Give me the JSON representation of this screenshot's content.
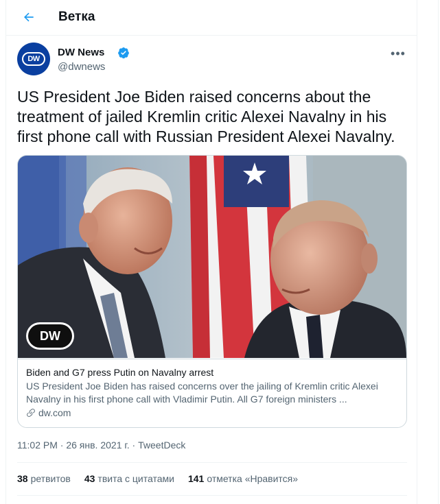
{
  "header": {
    "title": "Ветка",
    "back_icon": "arrow-left-icon"
  },
  "author": {
    "name": "DW News",
    "handle": "@dwnews",
    "avatar_text": "DW",
    "verified": true,
    "more_icon": "more-horizontal-icon"
  },
  "tweet": {
    "text": "US President Joe Biden raised concerns about the treatment of jailed Kremlin critic Alexei Navalny in his first phone call with Russian President Alexei Navalny."
  },
  "card": {
    "image_logo": "DW",
    "title": "Biden and G7 press Putin on Navalny arrest",
    "description": "US President Joe Biden has raised concerns over the jailing of Kremlin critic Alexei Navalny in his first phone call with Vladimir Putin. All G7 foreign ministers ...",
    "domain": "dw.com",
    "link_icon": "link-icon"
  },
  "meta": {
    "time": "11:02 PM",
    "separator": "·",
    "date": "26 янв. 2021 г.",
    "source": "TweetDeck"
  },
  "stats": {
    "retweets_count": "38",
    "retweets_label": "ретвитов",
    "quotes_count": "43",
    "quotes_label": "твита с цитатами",
    "likes_count": "141",
    "likes_label": "отметка «Нравится»"
  },
  "colors": {
    "accent": "#1d9bf0",
    "text_primary": "#0f1419",
    "text_secondary": "#536471",
    "border": "#cfd9de",
    "dw_blue": "#0a3fa0"
  }
}
